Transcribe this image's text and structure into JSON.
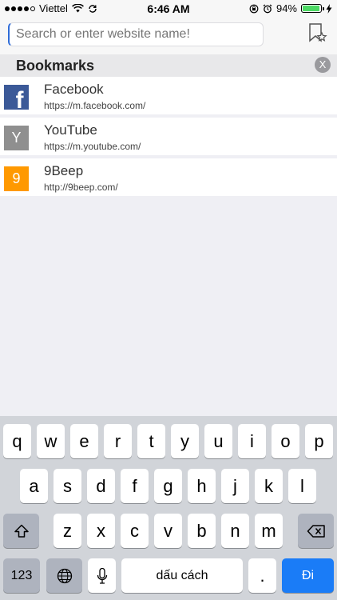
{
  "status_bar": {
    "carrier": "Viettel",
    "time": "6:46 AM",
    "battery": "94%",
    "battery_level": 0.94
  },
  "search": {
    "placeholder": "Search or enter website name!"
  },
  "bookmarks": {
    "title": "Bookmarks",
    "close_label": "X",
    "items": [
      {
        "title": "Facebook",
        "url": "https://m.facebook.com/",
        "icon": "f"
      },
      {
        "title": "YouTube",
        "url": "https://m.youtube.com/",
        "icon": "Y"
      },
      {
        "title": "9Beep",
        "url": "http://9beep.com/",
        "icon": "9"
      }
    ]
  },
  "keyboard": {
    "row1": [
      "q",
      "w",
      "e",
      "r",
      "t",
      "y",
      "u",
      "i",
      "o",
      "p"
    ],
    "row2": [
      "a",
      "s",
      "d",
      "f",
      "g",
      "h",
      "j",
      "k",
      "l"
    ],
    "row3": [
      "z",
      "x",
      "c",
      "v",
      "b",
      "n",
      "m"
    ],
    "numbers_label": "123",
    "space_label": "dấu cách",
    "period_label": ".",
    "go_label": "Đi"
  },
  "colors": {
    "accent": "#1a7cf7",
    "facebook": "#3b5998",
    "youtube": "#8f8f8f",
    "nine_beep": "#ff9900",
    "battery": "#4cd964"
  }
}
